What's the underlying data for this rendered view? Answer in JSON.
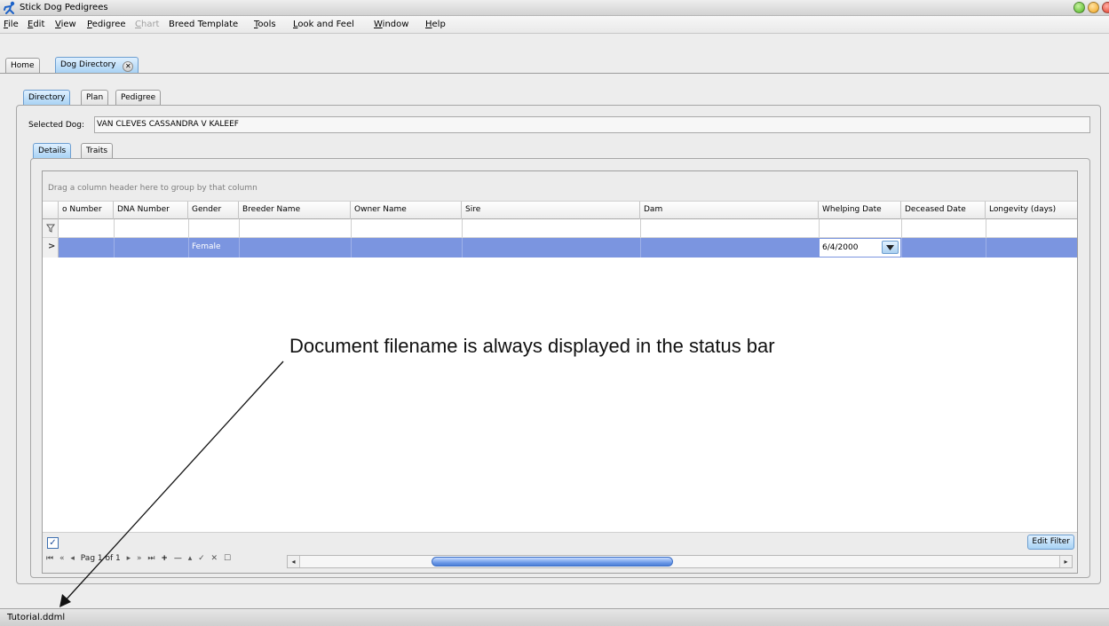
{
  "window": {
    "title": "Stick Dog Pedigrees"
  },
  "menu": {
    "items": [
      {
        "label": "File",
        "enabled": true
      },
      {
        "label": "Edit",
        "enabled": true
      },
      {
        "label": "View",
        "enabled": true
      },
      {
        "label": "Pedigree",
        "enabled": true
      },
      {
        "label": "Chart",
        "enabled": false
      },
      {
        "label": "Breed Template",
        "enabled": true
      },
      {
        "label": "Tools",
        "enabled": true
      },
      {
        "label": "Look and Feel",
        "enabled": true
      },
      {
        "label": "Window",
        "enabled": true
      },
      {
        "label": "Help",
        "enabled": true
      }
    ]
  },
  "doc_tabs": [
    {
      "label": "Home",
      "active": false
    },
    {
      "label": "Dog Directory",
      "active": true,
      "close_glyph": "✕"
    }
  ],
  "view_tabs": [
    {
      "label": "Directory",
      "active": true
    },
    {
      "label": "Plan",
      "active": false
    },
    {
      "label": "Pedigree",
      "active": false
    }
  ],
  "selected_dog": {
    "label": "Selected Dog:",
    "value": "VAN CLEVES CASSANDRA V KALEEF"
  },
  "detail_tabs": [
    {
      "label": "Details",
      "active": true
    },
    {
      "label": "Traits",
      "active": false
    }
  ],
  "grid": {
    "group_hint": "Drag a column header here to group by that column",
    "columns": [
      "o Number",
      "DNA Number",
      "Gender",
      "Breeder Name",
      "Owner Name",
      "Sire",
      "Dam",
      "Whelping Date",
      "Deceased Date",
      "Longevity (days)"
    ],
    "filter_icon": "filter-icon",
    "row_indicator": ">",
    "rows": [
      {
        "cells": [
          "",
          "",
          "Female",
          "",
          "",
          "",
          "",
          "6/4/2000",
          "",
          ""
        ]
      }
    ],
    "checkbox_checked": true,
    "checkbox_glyph": "✓",
    "edit_filter_label": "Edit Filter",
    "navigator": {
      "first": "⏮",
      "prev_page": "«",
      "prev": "◂",
      "page_text": "Pag 1 of 1",
      "next": "▸",
      "next_page": "»",
      "last": "⏭",
      "add": "+",
      "remove": "—",
      "up": "▴",
      "confirm": "✓",
      "cancel": "✕",
      "square": "☐",
      "scroll_left": "◂",
      "scroll_right": "▸"
    }
  },
  "annotation": {
    "text": "Document filename is always displayed in the status bar"
  },
  "status_bar": {
    "text": "Tutorial.ddml"
  },
  "colors": {
    "selection_row": "#7b95e0",
    "active_tab": "#a8d2f4",
    "scroll_thumb": "#6f9be8"
  }
}
